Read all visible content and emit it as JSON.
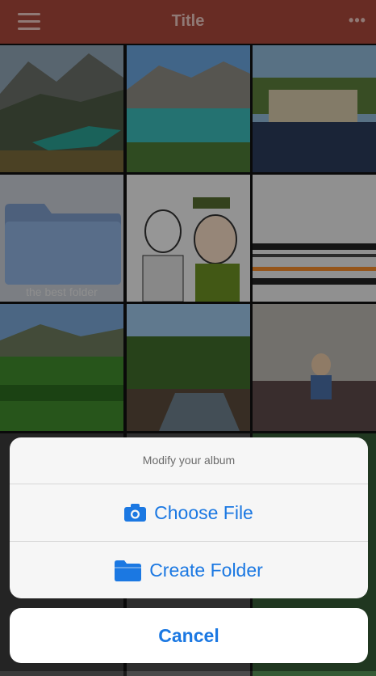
{
  "header": {
    "title": "Title",
    "more_label": "•••"
  },
  "grid": {
    "tiles": [
      {
        "kind": "photo",
        "icon": "mountain-lake-photo"
      },
      {
        "kind": "photo",
        "icon": "turquoise-lake-photo"
      },
      {
        "kind": "photo",
        "icon": "village-house-photo"
      },
      {
        "kind": "folder",
        "label": "the best folder"
      },
      {
        "kind": "photo",
        "icon": "cartoon-photo"
      },
      {
        "kind": "photo",
        "icon": "abstract-lines-photo"
      },
      {
        "kind": "photo",
        "icon": "green-valley-photo"
      },
      {
        "kind": "photo",
        "icon": "forest-stream-photo"
      },
      {
        "kind": "photo",
        "icon": "child-on-carpet-photo"
      }
    ]
  },
  "action_sheet": {
    "title": "Modify your album",
    "actions": [
      {
        "label": "Choose File",
        "icon": "camera-icon"
      },
      {
        "label": "Create Folder",
        "icon": "folder-icon"
      }
    ],
    "cancel_label": "Cancel"
  },
  "colors": {
    "header": "#a8473b",
    "accent": "#1b78e2"
  }
}
